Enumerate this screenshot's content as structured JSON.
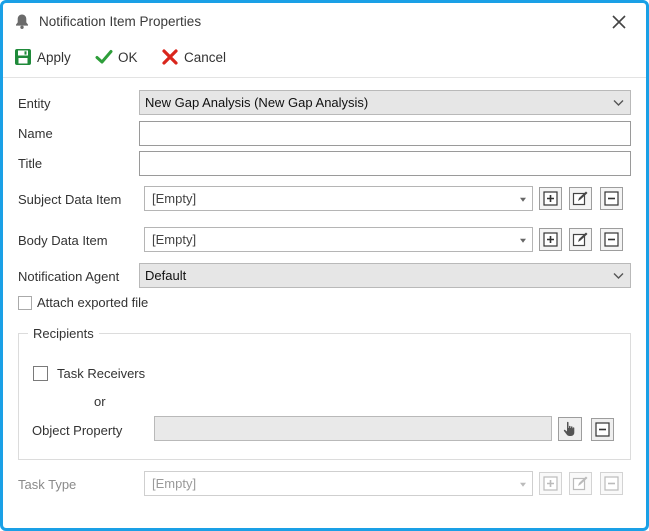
{
  "window": {
    "title": "Notification Item Properties",
    "bell_icon": "bell-icon",
    "close_icon": "close-icon"
  },
  "toolbar": {
    "apply_label": "Apply",
    "ok_label": "OK",
    "cancel_label": "Cancel"
  },
  "form": {
    "entity_label": "Entity",
    "entity_value": "New Gap Analysis (New Gap Analysis)",
    "name_label": "Name",
    "name_value": "",
    "title_label": "Title",
    "title_value": "",
    "subject_label": "Subject Data Item",
    "subject_value": "[Empty]",
    "body_label": "Body Data Item",
    "body_value": "[Empty]",
    "agent_label": "Notification Agent",
    "agent_value": "Default",
    "attach_label": "Attach exported file",
    "attach_checked": false
  },
  "recipients": {
    "group_label": "Recipients",
    "task_receivers_label": "Task Receivers",
    "task_receivers_checked": false,
    "or_label": "or",
    "object_property_label": "Object Property",
    "object_property_value": ""
  },
  "task_type": {
    "label": "Task Type",
    "value": "[Empty]"
  },
  "colors": {
    "window_border": "#1aa0e6",
    "ok_check": "#2e9e3a",
    "cancel_x": "#d9261c",
    "save_icon": "#1f8a3a"
  }
}
